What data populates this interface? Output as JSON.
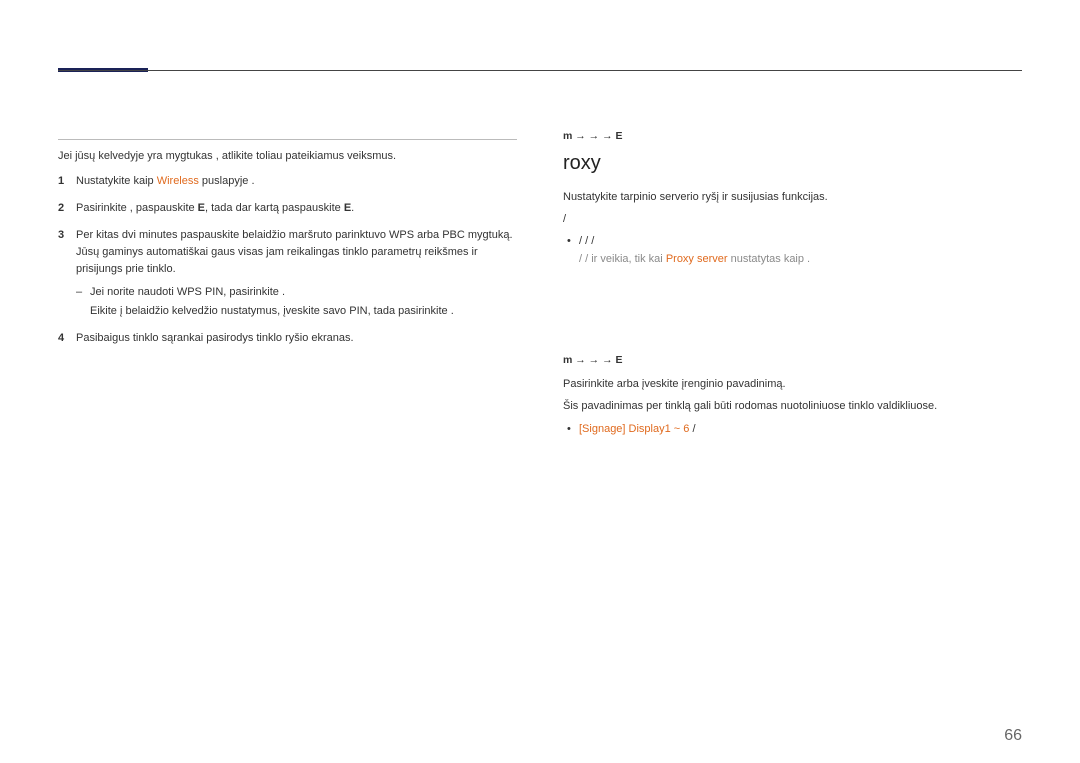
{
  "pageNumber": "66",
  "left": {
    "intro": "Jei jūsų kelvedyje yra mygtukas , atlikite toliau pateikiamus veiksmus.",
    "step1_a": "Nustatykite  kaip ",
    "step1_wireless": "Wireless",
    "step1_b": " puslapyje ",
    "step1_c": ".",
    "step2_a": "Pasirinkite , paspauskite ",
    "step2_E1": "E",
    "step2_mid": ", tada dar kartą paspauskite ",
    "step2_E2": "E",
    "step2_end": ".",
    "step3_l1": "Per kitas dvi minutes paspauskite belaidžio maršruto parinktuvo WPS arba PBC mygtuką.",
    "step3_l2": "Jūsų gaminys automatiškai gaus visas jam reikalingas tinklo parametrų reikšmes ir prisijungs prie tinklo.",
    "step3_sub": "Jei norite naudoti WPS PIN, pasirinkite .",
    "step3_sub2": "Eikite į belaidžio kelvedžio nustatymus, įveskite savo PIN, tada pasirinkite .",
    "step4": "Pasibaigus tinklo sąrankai pasirodys tinklo ryšio ekranas."
  },
  "right": {
    "nav1_a": "m → ",
    "nav1_b": " → ",
    "nav1_c": " → E",
    "heading": "roxy",
    "proxy_desc": "Nustatykite tarpinio serverio ryšį ir susijusias funkcijas.",
    "slash1": "/",
    "bullet1": " /  /  / ",
    "note_a": " /  /  ir ",
    "note_b": "veikia, tik kai ",
    "note_orange": "Proxy server",
    "note_c": " nustatytas kaip .",
    "nav2_a": "m → ",
    "nav2_b": " → ",
    "nav2_c": " → E",
    "dev_l1": "Pasirinkite arba įveskite įrenginio pavadinimą.",
    "dev_l2": "Šis pavadinimas per tinklą gali būti rodomas nuotoliniuose tinklo valdikliuose.",
    "dev_bullet_orange": "[Signage] Display1 ~ 6",
    "dev_bullet_rest": " / "
  }
}
